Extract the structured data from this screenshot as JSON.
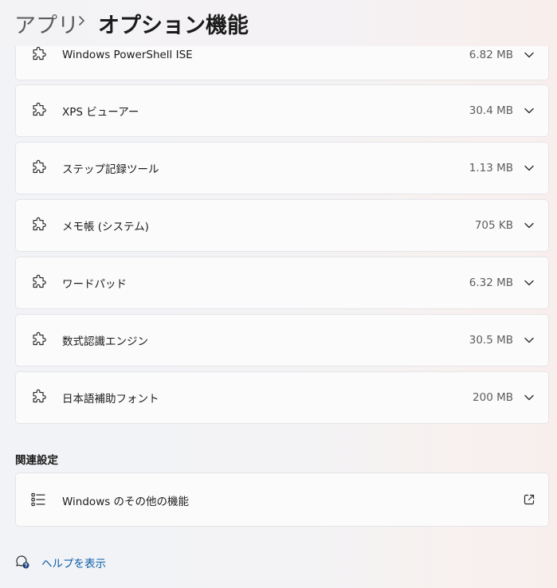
{
  "header": {
    "parent": "アプリ",
    "separator_icon": "chevron-right-icon",
    "title": "オプション機能"
  },
  "features": [
    {
      "name": "Windows PowerShell ISE",
      "size": "6.82 MB",
      "icon": "puzzle-icon"
    },
    {
      "name": "XPS ビューアー",
      "size": "30.4 MB",
      "icon": "puzzle-icon"
    },
    {
      "name": "ステップ記録ツール",
      "size": "1.13 MB",
      "icon": "puzzle-icon"
    },
    {
      "name": "メモ帳 (システム)",
      "size": "705 KB",
      "icon": "puzzle-icon"
    },
    {
      "name": "ワードパッド",
      "size": "6.32 MB",
      "icon": "puzzle-icon"
    },
    {
      "name": "数式認識エンジン",
      "size": "30.5 MB",
      "icon": "puzzle-icon"
    },
    {
      "name": "日本語補助フォント",
      "size": "200 MB",
      "icon": "puzzle-icon"
    }
  ],
  "related": {
    "title": "関連設定",
    "items": [
      {
        "label": "Windows のその他の機能",
        "icon": "list-icon",
        "action_icon": "external-link-icon"
      }
    ]
  },
  "help": {
    "label": "ヘルプを表示",
    "icon": "help-chat-icon"
  },
  "colors": {
    "link": "#0a5ea8",
    "card_bg": "#fbfbfc",
    "card_border": "#e5e5e8"
  }
}
